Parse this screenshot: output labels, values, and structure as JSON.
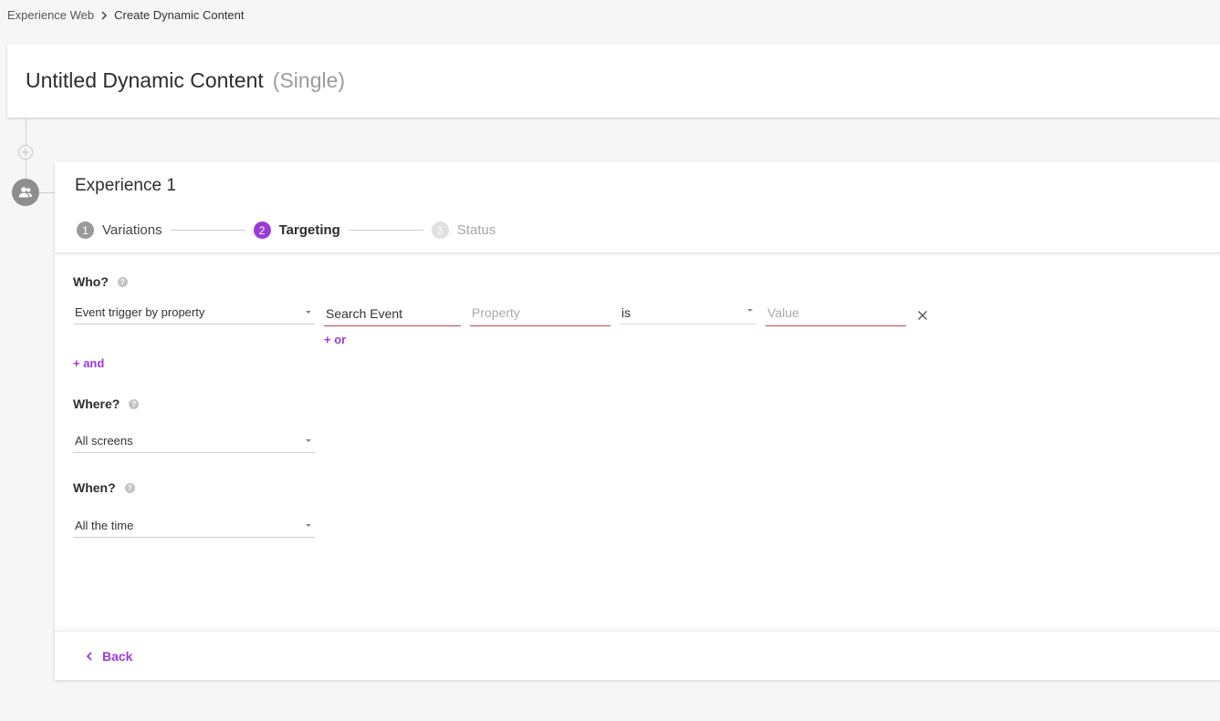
{
  "breadcrumb": {
    "parent": "Experience Web",
    "current": "Create Dynamic Content"
  },
  "page": {
    "title": "Untitled Dynamic Content",
    "subtitle": "(Single)"
  },
  "experience": {
    "title": "Experience 1",
    "steps": [
      {
        "number": "1",
        "label": "Variations",
        "state": "done"
      },
      {
        "number": "2",
        "label": "Targeting",
        "state": "active"
      },
      {
        "number": "3",
        "label": "Status",
        "state": "inactive"
      }
    ]
  },
  "who": {
    "label": "Who?",
    "trigger_select": "Event trigger by property",
    "event_input": "Search Event",
    "property_placeholder": "Property",
    "operator_select": "is",
    "value_placeholder": "Value",
    "or_link": "+ or",
    "and_link": "+ and"
  },
  "where": {
    "label": "Where?",
    "select": "All screens"
  },
  "when": {
    "label": "When?",
    "select": "All the time"
  },
  "footer": {
    "back_label": "Back"
  },
  "colors": {
    "accent": "#9b3bd6",
    "error_underline": "#c9414c",
    "background": "#f6f6f7"
  },
  "icons": {
    "help": "help-icon",
    "close": "close-icon",
    "back": "chevron-left-icon",
    "user_group": "users-icon",
    "add": "plus-circle-icon"
  }
}
